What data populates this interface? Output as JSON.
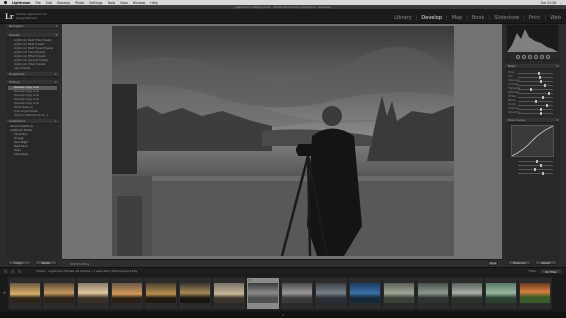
{
  "menubar": {
    "app": "Lightroom",
    "items": [
      "File",
      "Edit",
      "Develop",
      "Photo",
      "Settings",
      "Tools",
      "View",
      "Window",
      "Help"
    ],
    "clock": "Tue 21:26"
  },
  "window_title": "Lightroom Catalog.lrcat - Adobe Photoshop Lightroom - Develop",
  "identity": {
    "logo": "Lr",
    "line1": "Adobe Lightroom CC",
    "line2": "Serge Ramelli"
  },
  "modules": [
    "Library",
    "Develop",
    "Map",
    "Book",
    "Slideshow",
    "Print",
    "Web"
  ],
  "active_module": "Develop",
  "left_panel": {
    "navigator": "Navigator",
    "presets_header": "Presets",
    "preset_group_a": [
      "Lightroom B&W Filter Presets",
      "Lightroom B&W Presets",
      "Lightroom B&W Toned Presets",
      "Lightroom Color Presets",
      "Lightroom Effect Presets",
      "Lightroom General Presets",
      "Lightroom Video Presets",
      "User Presets"
    ],
    "snapshots_header": "Snapshots",
    "history_header": "History",
    "history_items": [
      "Develop Copy Look",
      "Develop Copy Look",
      "Develop Copy Look",
      "Develop Copy Look",
      "Develop Copy Look",
      "White Balance",
      "Crop Angle Rotate",
      "Import (10/25/16 10:14...)"
    ],
    "collections_header": "Collections",
    "collections": [
      "Smart Collections",
      "Lightroom Mobile",
      "TIF photos",
      "Orange",
      "Paris Night",
      "Next Serie",
      "Trees",
      "Cityscapes"
    ],
    "copy_btn": "Copy...",
    "paste_btn": "Paste"
  },
  "toolbar": {
    "soft_proofing": "Soft Proofing",
    "done_btn": "Done"
  },
  "right_panel": {
    "histogram": "Histogram",
    "basic_header": "Basic",
    "sliders": [
      "Temp",
      "Tint",
      "Exposure",
      "Contrast",
      "Highlights",
      "Shadows",
      "Whites",
      "Blacks",
      "Clarity",
      "Vibrance",
      "Saturation"
    ],
    "tone_curve_header": "Tone Curve",
    "previous_btn": "Previous",
    "reset_btn": "Reset"
  },
  "filmstrip_bar": {
    "path": "Folder : Lightroom Mobile   10 photos / 1 selected / 00Chermay-kirby",
    "filter_label": "Filter :",
    "filter_value": "No Filter"
  },
  "filmstrip": {
    "selected_index": 7,
    "selected_number": "8"
  },
  "colors": {
    "accent": "#e8e8e8",
    "panel_bg": "#282828",
    "workspace_bg": "#737373"
  }
}
